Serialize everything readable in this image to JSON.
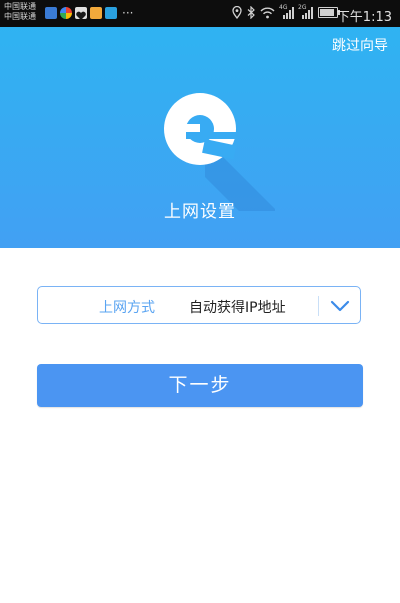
{
  "status_bar": {
    "carrier_1": "中国联通",
    "carrier_2": "中国联通",
    "overflow": "···",
    "network_1": "4G",
    "network_2": "2G",
    "battery_level": 0.85,
    "time": "下午1:13"
  },
  "header": {
    "skip_label": "跳过向导",
    "title": "上网设置",
    "gradient_top": "#2fb3f2",
    "gradient_bottom": "#42a0f3"
  },
  "form": {
    "connection_label": "上网方式",
    "connection_value": "自动获得IP地址",
    "dropdown_icon": "chevron-down-icon",
    "accent": "#5aa4f2"
  },
  "actions": {
    "next_label": "下一步",
    "button_color": "#4b95f2"
  }
}
